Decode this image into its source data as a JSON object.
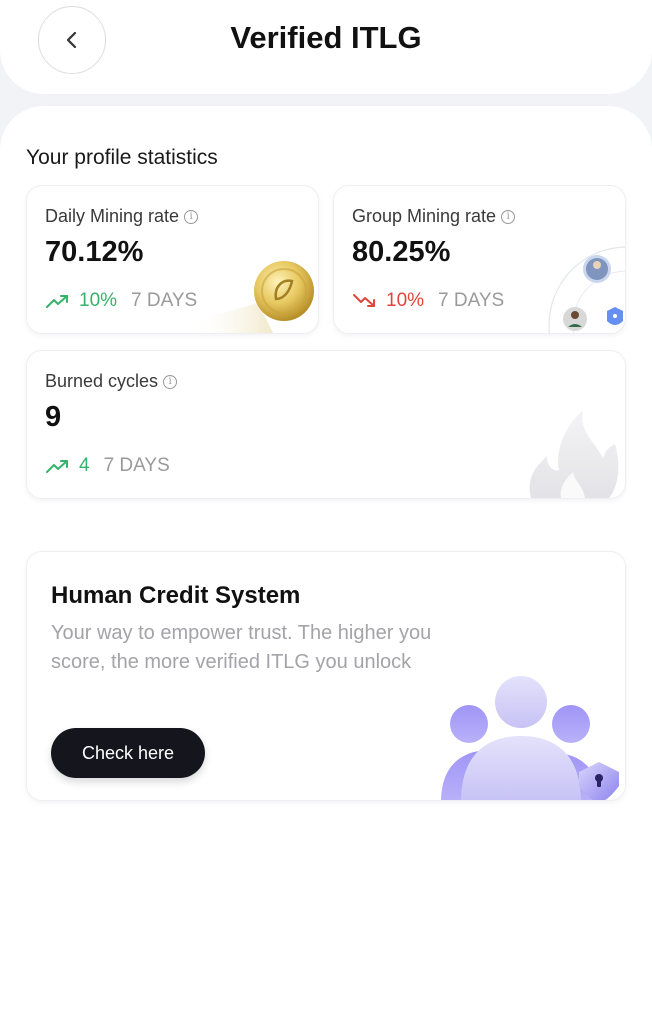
{
  "header": {
    "title": "Verified ITLG"
  },
  "stats": {
    "section_title": "Your profile statistics",
    "daily_mining": {
      "label": "Daily Mining rate",
      "value": "70.12%",
      "trend_value": "10%",
      "trend_direction": "up",
      "period": "7 DAYS"
    },
    "group_mining": {
      "label": "Group Mining rate",
      "value": "80.25%",
      "trend_value": "10%",
      "trend_direction": "down",
      "period": "7 DAYS"
    },
    "burned_cycles": {
      "label": "Burned cycles",
      "value": "9",
      "trend_value": "4",
      "trend_direction": "up",
      "period": "7 DAYS"
    }
  },
  "credit": {
    "title": "Human Credit System",
    "description": "Your way to empower trust. The higher you score, the more verified ITLG you unlock",
    "button_label": "Check here"
  },
  "colors": {
    "trend_up": "#34b36a",
    "trend_down": "#e0453a",
    "button_bg": "#15151d",
    "accent_purple": "#8f84f5"
  },
  "icons": {
    "back": "chevron-left-icon",
    "info": "info-icon",
    "trend_up": "trend-up-icon",
    "trend_down": "trend-down-icon"
  }
}
